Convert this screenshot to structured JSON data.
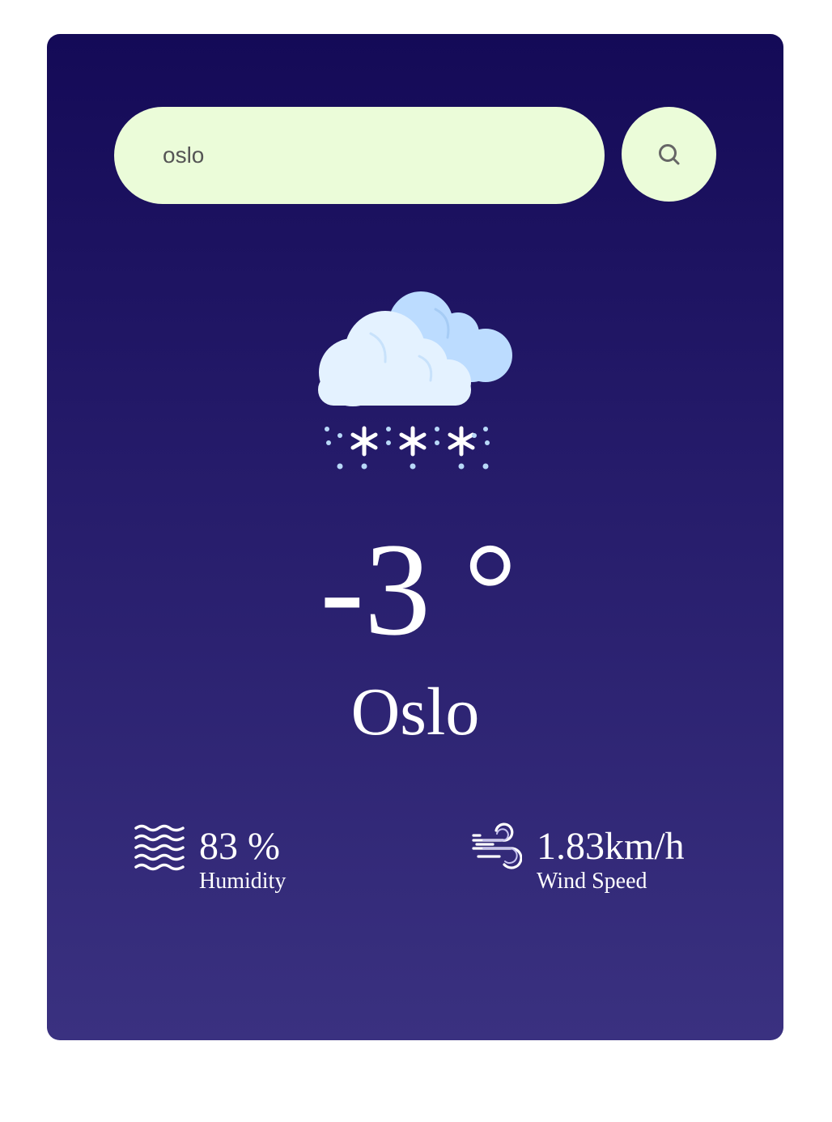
{
  "search": {
    "value": "oslo",
    "button_icon": "search-icon"
  },
  "weather": {
    "condition_icon": "snow-cloud-icon",
    "temperature": "-3 °",
    "city": "Oslo"
  },
  "details": {
    "humidity": {
      "icon": "humidity-icon",
      "value": "83 %",
      "label": "Humidity"
    },
    "wind": {
      "icon": "wind-icon",
      "value": "1.83km/h",
      "label": "Wind Speed"
    }
  },
  "colors": {
    "card_top": "#140a57",
    "card_bottom": "#3a3180",
    "search_bg": "#ebfcd9",
    "text": "#ffffff"
  }
}
